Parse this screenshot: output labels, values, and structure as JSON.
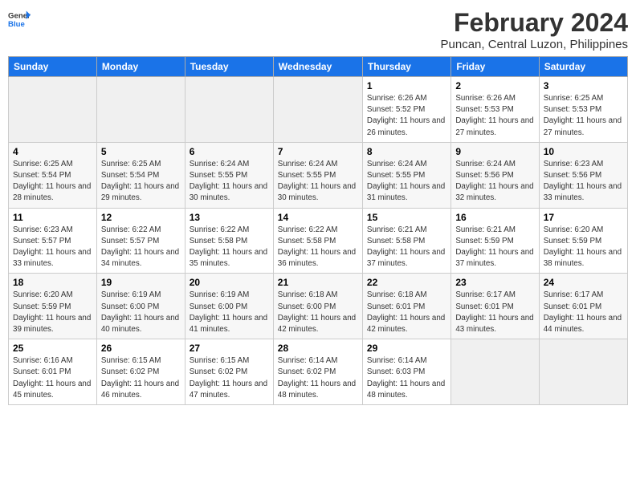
{
  "header": {
    "logo_line1": "General",
    "logo_line2": "Blue",
    "month_title": "February 2024",
    "location": "Puncan, Central Luzon, Philippines"
  },
  "weekdays": [
    "Sunday",
    "Monday",
    "Tuesday",
    "Wednesday",
    "Thursday",
    "Friday",
    "Saturday"
  ],
  "weeks": [
    [
      {
        "day": "",
        "info": ""
      },
      {
        "day": "",
        "info": ""
      },
      {
        "day": "",
        "info": ""
      },
      {
        "day": "",
        "info": ""
      },
      {
        "day": "1",
        "info": "Sunrise: 6:26 AM\nSunset: 5:52 PM\nDaylight: 11 hours and 26 minutes."
      },
      {
        "day": "2",
        "info": "Sunrise: 6:26 AM\nSunset: 5:53 PM\nDaylight: 11 hours and 27 minutes."
      },
      {
        "day": "3",
        "info": "Sunrise: 6:25 AM\nSunset: 5:53 PM\nDaylight: 11 hours and 27 minutes."
      }
    ],
    [
      {
        "day": "4",
        "info": "Sunrise: 6:25 AM\nSunset: 5:54 PM\nDaylight: 11 hours and 28 minutes."
      },
      {
        "day": "5",
        "info": "Sunrise: 6:25 AM\nSunset: 5:54 PM\nDaylight: 11 hours and 29 minutes."
      },
      {
        "day": "6",
        "info": "Sunrise: 6:24 AM\nSunset: 5:55 PM\nDaylight: 11 hours and 30 minutes."
      },
      {
        "day": "7",
        "info": "Sunrise: 6:24 AM\nSunset: 5:55 PM\nDaylight: 11 hours and 30 minutes."
      },
      {
        "day": "8",
        "info": "Sunrise: 6:24 AM\nSunset: 5:55 PM\nDaylight: 11 hours and 31 minutes."
      },
      {
        "day": "9",
        "info": "Sunrise: 6:24 AM\nSunset: 5:56 PM\nDaylight: 11 hours and 32 minutes."
      },
      {
        "day": "10",
        "info": "Sunrise: 6:23 AM\nSunset: 5:56 PM\nDaylight: 11 hours and 33 minutes."
      }
    ],
    [
      {
        "day": "11",
        "info": "Sunrise: 6:23 AM\nSunset: 5:57 PM\nDaylight: 11 hours and 33 minutes."
      },
      {
        "day": "12",
        "info": "Sunrise: 6:22 AM\nSunset: 5:57 PM\nDaylight: 11 hours and 34 minutes."
      },
      {
        "day": "13",
        "info": "Sunrise: 6:22 AM\nSunset: 5:58 PM\nDaylight: 11 hours and 35 minutes."
      },
      {
        "day": "14",
        "info": "Sunrise: 6:22 AM\nSunset: 5:58 PM\nDaylight: 11 hours and 36 minutes."
      },
      {
        "day": "15",
        "info": "Sunrise: 6:21 AM\nSunset: 5:58 PM\nDaylight: 11 hours and 37 minutes."
      },
      {
        "day": "16",
        "info": "Sunrise: 6:21 AM\nSunset: 5:59 PM\nDaylight: 11 hours and 37 minutes."
      },
      {
        "day": "17",
        "info": "Sunrise: 6:20 AM\nSunset: 5:59 PM\nDaylight: 11 hours and 38 minutes."
      }
    ],
    [
      {
        "day": "18",
        "info": "Sunrise: 6:20 AM\nSunset: 5:59 PM\nDaylight: 11 hours and 39 minutes."
      },
      {
        "day": "19",
        "info": "Sunrise: 6:19 AM\nSunset: 6:00 PM\nDaylight: 11 hours and 40 minutes."
      },
      {
        "day": "20",
        "info": "Sunrise: 6:19 AM\nSunset: 6:00 PM\nDaylight: 11 hours and 41 minutes."
      },
      {
        "day": "21",
        "info": "Sunrise: 6:18 AM\nSunset: 6:00 PM\nDaylight: 11 hours and 42 minutes."
      },
      {
        "day": "22",
        "info": "Sunrise: 6:18 AM\nSunset: 6:01 PM\nDaylight: 11 hours and 42 minutes."
      },
      {
        "day": "23",
        "info": "Sunrise: 6:17 AM\nSunset: 6:01 PM\nDaylight: 11 hours and 43 minutes."
      },
      {
        "day": "24",
        "info": "Sunrise: 6:17 AM\nSunset: 6:01 PM\nDaylight: 11 hours and 44 minutes."
      }
    ],
    [
      {
        "day": "25",
        "info": "Sunrise: 6:16 AM\nSunset: 6:01 PM\nDaylight: 11 hours and 45 minutes."
      },
      {
        "day": "26",
        "info": "Sunrise: 6:15 AM\nSunset: 6:02 PM\nDaylight: 11 hours and 46 minutes."
      },
      {
        "day": "27",
        "info": "Sunrise: 6:15 AM\nSunset: 6:02 PM\nDaylight: 11 hours and 47 minutes."
      },
      {
        "day": "28",
        "info": "Sunrise: 6:14 AM\nSunset: 6:02 PM\nDaylight: 11 hours and 48 minutes."
      },
      {
        "day": "29",
        "info": "Sunrise: 6:14 AM\nSunset: 6:03 PM\nDaylight: 11 hours and 48 minutes."
      },
      {
        "day": "",
        "info": ""
      },
      {
        "day": "",
        "info": ""
      }
    ]
  ]
}
